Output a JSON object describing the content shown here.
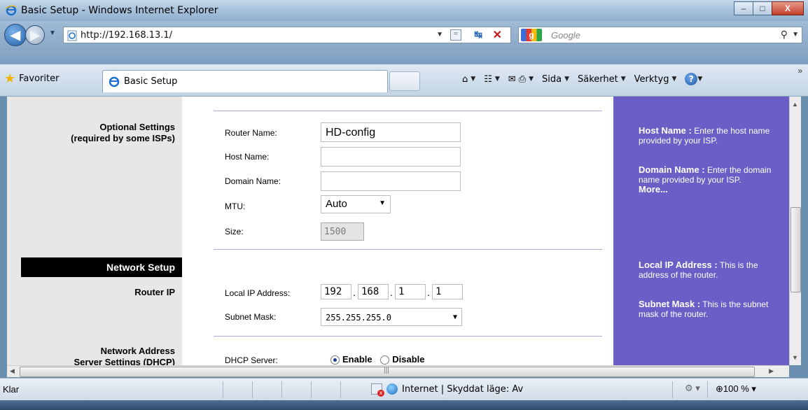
{
  "window": {
    "title": "Basic Setup - Windows Internet Explorer",
    "minimize": "–",
    "maximize": "□",
    "close": "X"
  },
  "address": {
    "url": "http://192.168.13.1/",
    "search_placeholder": "Google",
    "search_logo": "g"
  },
  "command_bar": {
    "favorites_label": "Favoriter",
    "tab_label": "Basic Setup",
    "menus": [
      "Sida",
      "Säkerhet",
      "Verktyg"
    ]
  },
  "left": {
    "optional_settings": "Optional Settings",
    "optional_settings_sub": "(required by some ISPs)",
    "network_setup": "Network Setup",
    "router_ip": "Router IP",
    "network_address": "Network Address",
    "server_settings": "Server Settings (DHCP)"
  },
  "form": {
    "router_name_label": "Router Name:",
    "router_name_value": "HD-config",
    "host_name_label": "Host Name:",
    "host_name_value": "",
    "domain_name_label": "Domain Name:",
    "domain_name_value": "",
    "mtu_label": "MTU:",
    "mtu_value": "Auto",
    "size_label": "Size:",
    "size_value": "1500",
    "local_ip_label": "Local IP Address:",
    "local_ip": [
      "192",
      "168",
      "1",
      "1"
    ],
    "subnet_mask_label": "Subnet Mask:",
    "subnet_mask_value": "255.255.255.0",
    "dhcp_server_label": "DHCP Server:",
    "dhcp_enable": "Enable",
    "dhcp_disable": "Disable",
    "dhcp_selected": "Enable"
  },
  "help": {
    "host_name_title": "Host Name :",
    "host_name_text": "Enter the host name provided by your ISP.",
    "domain_name_title": "Domain Name :",
    "domain_name_text": "Enter the domain name provided by your ISP.",
    "more": "More...",
    "local_ip_title": "Local IP Address :",
    "local_ip_text": "This is the address of the router.",
    "subnet_title": "Subnet Mask :",
    "subnet_text": "This is the subnet mask of the router."
  },
  "status": {
    "left_text": "Klar",
    "zone_text": "Internet | Skyddat läge: Av",
    "zoom": "100 %"
  },
  "colors": {
    "help_panel": "#6b5fc7",
    "left_panel": "#e7e7e7",
    "divider": "#b0a8d8"
  }
}
